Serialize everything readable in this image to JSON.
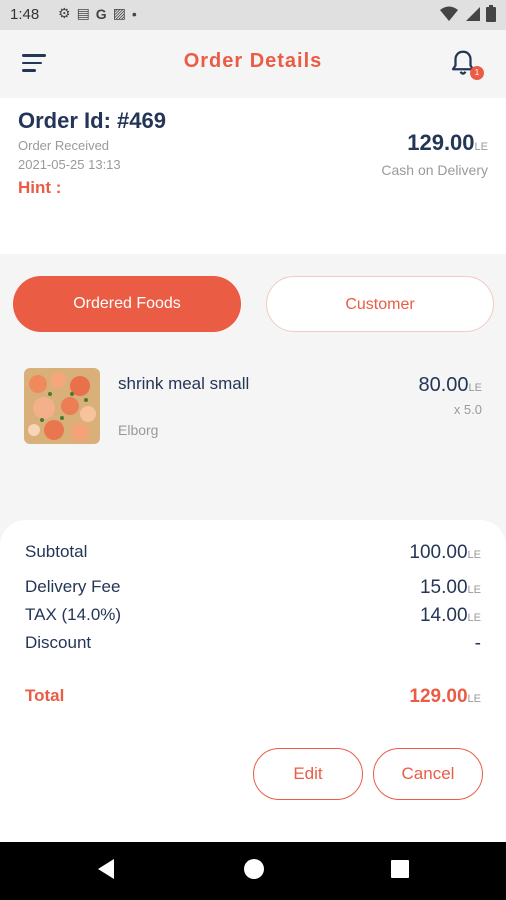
{
  "status_bar": {
    "time": "1:48",
    "icons": [
      "gear-icon",
      "message-icon",
      "google-icon",
      "image-icon",
      "dot-icon"
    ],
    "right_icons": [
      "wifi-icon",
      "signal-icon",
      "battery-icon"
    ]
  },
  "app_bar": {
    "title": "Order Details",
    "notification_count": "1"
  },
  "order": {
    "id": "Order Id: #469",
    "status": "Order Received",
    "date": "2021-05-25 13:13",
    "hint": "Hint :",
    "total": "129.00",
    "currency": "LE",
    "payment": "Cash on Delivery"
  },
  "tabs": {
    "foods": "Ordered Foods",
    "customer": "Customer"
  },
  "items": [
    {
      "name": "shrink meal small",
      "restaurant": "Elborg",
      "price": "80.00",
      "currency": "LE",
      "qty": "x 5.0"
    }
  ],
  "summary": {
    "subtotal_label": "Subtotal",
    "subtotal": "100.00",
    "delivery_label": "Delivery Fee",
    "delivery": "15.00",
    "tax_label": "TAX (14.0%)",
    "tax": "14.00",
    "discount_label": "Discount",
    "discount": "-",
    "total_label": "Total",
    "total": "129.00",
    "currency": "LE"
  },
  "buttons": {
    "edit": "Edit",
    "cancel": "Cancel"
  },
  "colors": {
    "accent": "#ea5c44",
    "text": "#243656"
  }
}
